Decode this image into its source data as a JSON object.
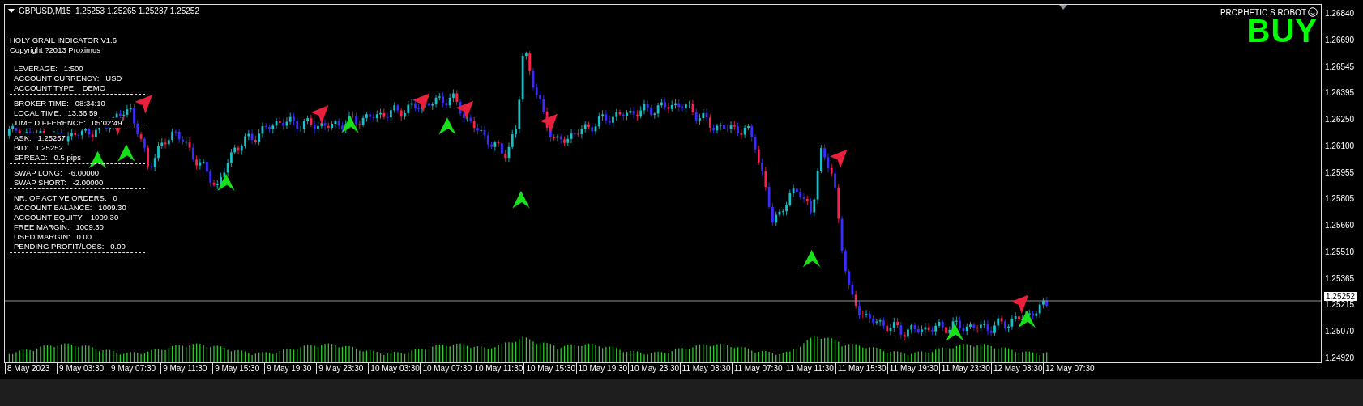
{
  "symbol_bar": "GBPUSD,M15  1.25253 1.25265 1.25237 1.25252",
  "indicator_panel": {
    "title": "HOLY GRAIL INDICATOR V1.6",
    "copyright": "Copyright ?2013 Proximus",
    "sections": [
      [
        "LEVERAGE:   1:500",
        "ACCOUNT CURRENCY:   USD",
        "ACCOUNT TYPE:   DEMO"
      ],
      [
        "BROKER TIME:   08:34:10",
        "LOCAL TIME:   13:36:59",
        "TIME DIFFERENCE:   05:02:49"
      ],
      [
        "ASK:   1.25257",
        "BID:   1.25252",
        "SPREAD:   0.5 pips"
      ],
      [
        "SWAP LONG:   -6.00000",
        "SWAP SHORT:   -2.00000"
      ],
      [
        "NR. OF ACTIVE ORDERS:   0",
        "ACCOUNT BALANCE:   1009.30",
        "ACCOUNT EQUITY:   1009.30",
        "FREE MARGIN:   1009.30",
        "USED MARGIN:   0.00",
        "PENDING PROFIT/LOSS:   0.00"
      ]
    ]
  },
  "robot": {
    "name": "PROPHETIC S ROBOT",
    "signal": "BUY"
  },
  "price_axis": {
    "ticks": [
      "1.26840",
      "1.26690",
      "1.26545",
      "1.26395",
      "1.26250",
      "1.26100",
      "1.25955",
      "1.25805",
      "1.25660",
      "1.25510",
      "1.25365",
      "1.25215",
      "1.25070",
      "1.24920"
    ],
    "current_price": "1.25252"
  },
  "time_axis": [
    "8 May 2023",
    "9 May 03:30",
    "9 May 07:30",
    "9 May 11:30",
    "9 May 15:30",
    "9 May 19:30",
    "9 May 23:30",
    "10 May 03:30",
    "10 May 07:30",
    "10 May 11:30",
    "10 May 15:30",
    "10 May 19:30",
    "10 May 23:30",
    "11 May 03:30",
    "11 May 07:30",
    "11 May 11:30",
    "11 May 15:30",
    "11 May 19:30",
    "11 May 23:30",
    "12 May 03:30",
    "12 May 07:30"
  ]
}
